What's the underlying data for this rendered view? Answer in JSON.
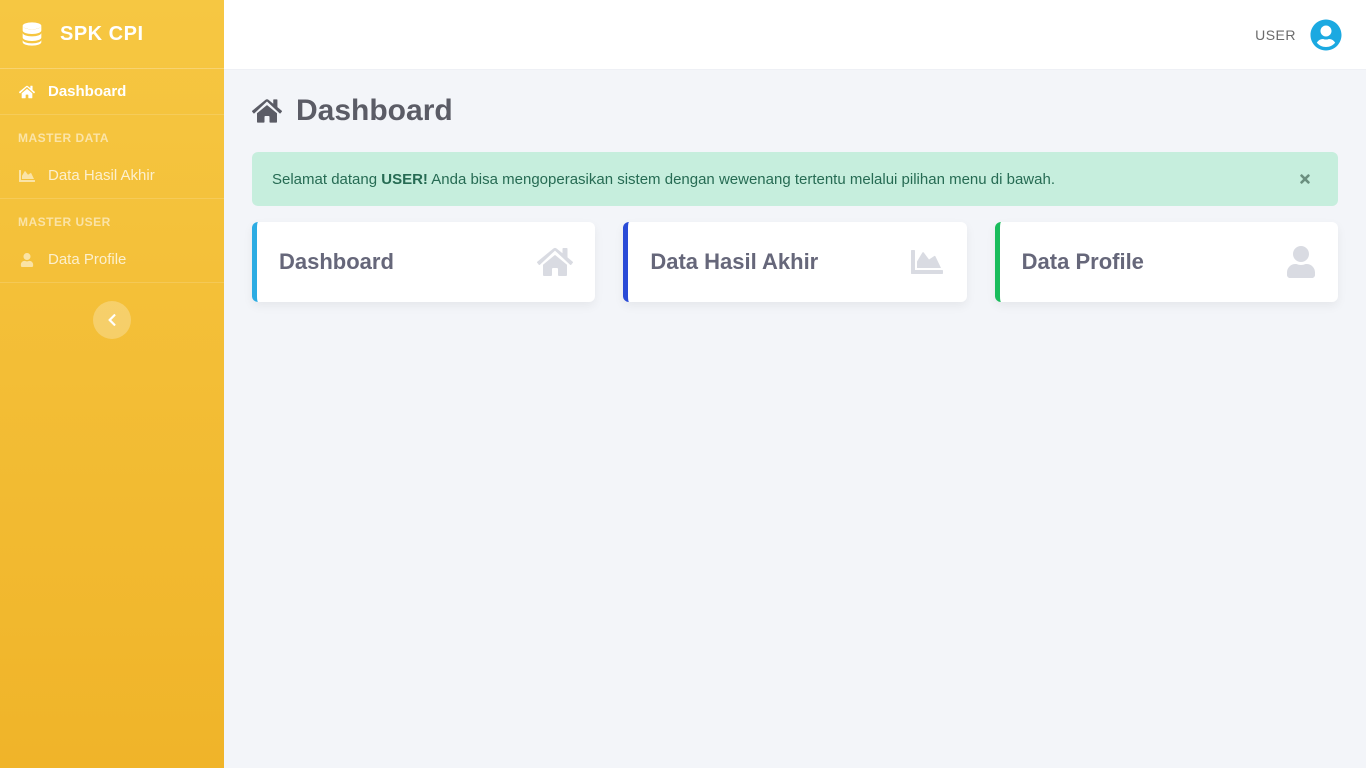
{
  "brand": {
    "name": "SPK CPI"
  },
  "sidebar": {
    "dashboard_label": "Dashboard",
    "section_master_data": "MASTER DATA",
    "item_hasil_akhir": "Data Hasil Akhir",
    "section_master_user": "MASTER USER",
    "item_profile": "Data Profile"
  },
  "topbar": {
    "user_label": "USER"
  },
  "page": {
    "title": "Dashboard"
  },
  "alert": {
    "pre": "Selamat datang ",
    "strong": "USER!",
    "post": " Anda bisa mengoperasikan sistem dengan wewenang tertentu melalui pilihan menu di bawah."
  },
  "cards": {
    "dashboard": "Dashboard",
    "hasil_akhir": "Data Hasil Akhir",
    "profile": "Data Profile"
  }
}
